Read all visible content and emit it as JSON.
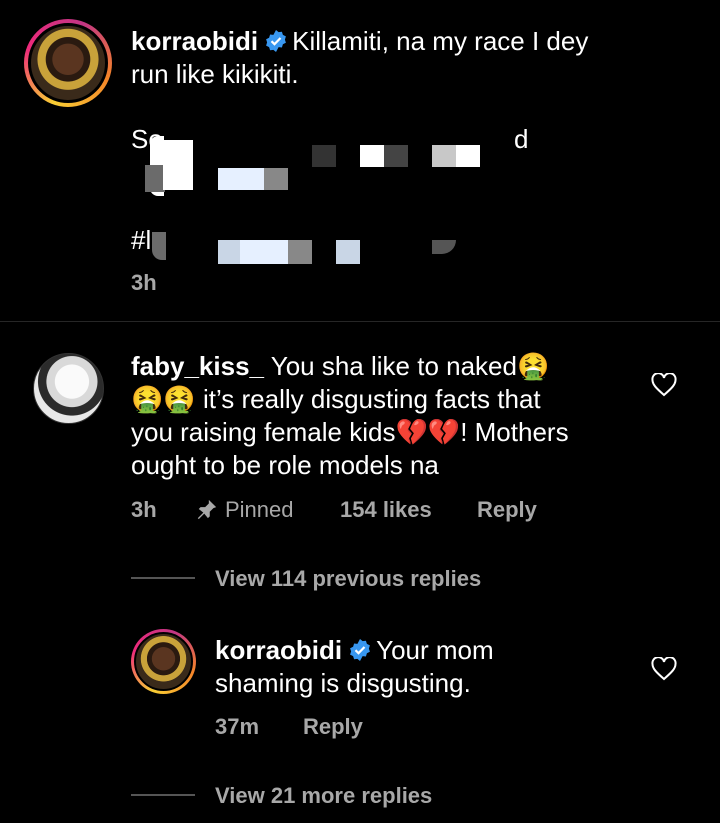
{
  "caption": {
    "username": "korraobidi",
    "text_line1": "Killamiti, na my race I dey",
    "text_line2": "run like kikikiti.",
    "song_prefix": "So",
    "song_suffix": "d",
    "hashtag_prefix": "#l",
    "time": "3h"
  },
  "comment": {
    "username": "faby_kiss_",
    "text_line1": "You sha like to naked🤮",
    "text_line2": "🤮🤮 it’s really disgusting facts that",
    "text_line3": "you raising female kids💔💔! Mothers",
    "text_line4": "ought to be role models na",
    "time": "3h",
    "pinned": "Pinned",
    "likes": "154 likes",
    "reply": "Reply",
    "view_previous": "View 114 previous replies"
  },
  "reply": {
    "username": "korraobidi",
    "text_line1": "Your mom",
    "text_line2": "shaming is disgusting.",
    "time": "37m",
    "reply": "Reply",
    "view_more": "View 21 more replies"
  },
  "colors": {
    "background": "#000000",
    "meta_text": "#a8a8a8",
    "verified": "#3897f0"
  }
}
